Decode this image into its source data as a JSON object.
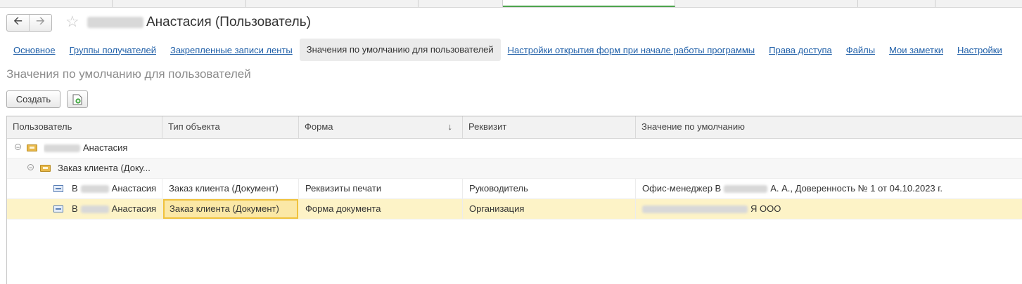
{
  "header": {
    "title_visible": "Анастасия (Пользователь)"
  },
  "links": [
    {
      "label": "Основное",
      "current": false
    },
    {
      "label": "Группы получателей",
      "current": false
    },
    {
      "label": "Закрепленные записи ленты",
      "current": false
    },
    {
      "label": "Значения по умолчанию для пользователей",
      "current": true
    },
    {
      "label": "Настройки открытия форм при начале работы программы",
      "current": false
    },
    {
      "label": "Права доступа",
      "current": false
    },
    {
      "label": "Файлы",
      "current": false
    },
    {
      "label": "Мои заметки",
      "current": false
    },
    {
      "label": "Настройки",
      "current": false
    }
  ],
  "section_title": "Значения по умолчанию для пользователей",
  "toolbar": {
    "create_label": "Создать"
  },
  "table": {
    "columns": [
      "Пользователь",
      "Тип объекта",
      "Форма",
      "Реквизит",
      "Значение по умолчанию"
    ],
    "sort_indicator": "↓",
    "group1_label": "Анастасия",
    "group2_label": "Заказ клиента (Доку...",
    "rows": [
      {
        "user": "Анастасия",
        "type": "Заказ клиента (Документ)",
        "form": "Реквизиты печати",
        "attr": "Руководитель",
        "value_a": "Офис-менеджер В",
        "value_b": "А. А., Доверенность № 1 от 04.10.2023 г."
      },
      {
        "user": "Анастасия",
        "type": "Заказ клиента (Документ)",
        "form": "Форма документа",
        "attr": "Организация",
        "value_a": "",
        "value_b": "Я ООО"
      }
    ]
  },
  "colors": {
    "link": "#1f5fa8",
    "selected_row": "#fdf3c7",
    "focus_border": "#f0c23c",
    "active_tab_accent": "#4ca34c"
  }
}
